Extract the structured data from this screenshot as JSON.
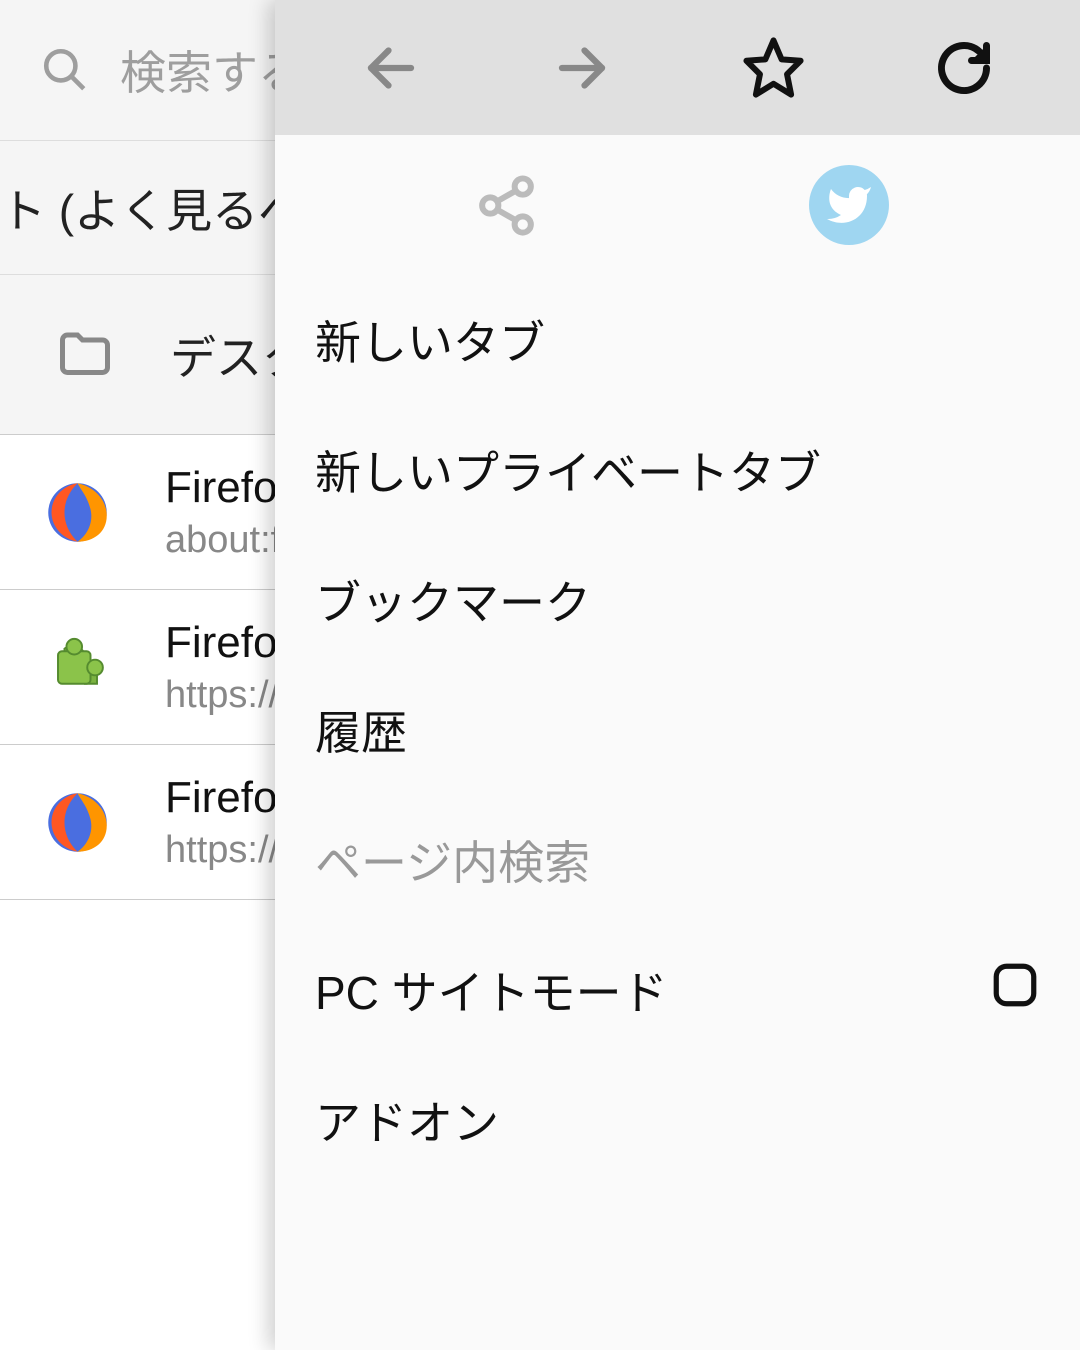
{
  "search": {
    "placeholder": "検索する"
  },
  "section_label": "ト (よく見るペー",
  "folder_label": "デスク",
  "bookmarks": [
    {
      "title": "Firefo",
      "url": "about:f",
      "icon": "firefox"
    },
    {
      "title": "Firefo",
      "url": "https://",
      "icon": "puzzle"
    },
    {
      "title": "Firefo",
      "url": "https://",
      "icon": "firefox"
    }
  ],
  "menu": {
    "new_tab": "新しいタブ",
    "new_private_tab": "新しいプライベートタブ",
    "bookmarks": "ブックマーク",
    "history": "履歴",
    "find_in_page": "ページ内検索",
    "desktop_site": "PC サイトモード",
    "addons": "アドオン"
  }
}
